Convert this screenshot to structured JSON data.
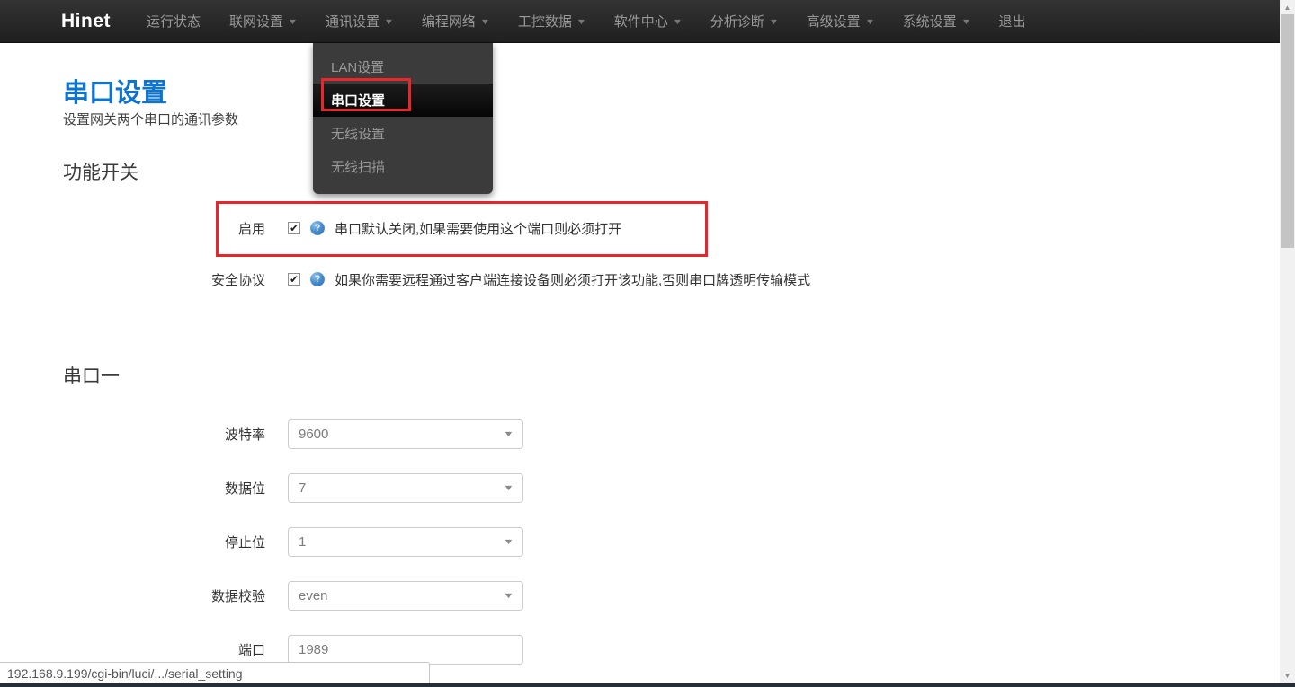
{
  "colors": {
    "accent_blue": "#0d74d1",
    "highlight_red": "#e8262b",
    "navbar_bg": "#2a2a2a",
    "dropdown_bg": "#3b3b3b",
    "taskbar_strip": "#233038"
  },
  "icons": {
    "caret": "▼",
    "check": "✔",
    "help": "?",
    "scroll_up": "▲",
    "scroll_down": "▼"
  },
  "navbar": {
    "brand": "Hinet",
    "items": [
      {
        "label": "运行状态",
        "caret": false
      },
      {
        "label": "联网设置",
        "caret": true
      },
      {
        "label": "通讯设置",
        "caret": true
      },
      {
        "label": "编程网络",
        "caret": true
      },
      {
        "label": "工控数据",
        "caret": true
      },
      {
        "label": "软件中心",
        "caret": true
      },
      {
        "label": "分析诊断",
        "caret": true
      },
      {
        "label": "高级设置",
        "caret": true
      },
      {
        "label": "系统设置",
        "caret": true
      },
      {
        "label": "退出",
        "caret": false
      }
    ]
  },
  "dropdown": {
    "items": [
      {
        "label": "LAN设置",
        "active": false
      },
      {
        "label": "串口设置",
        "active": true
      },
      {
        "label": "无线设置",
        "active": false
      },
      {
        "label": "无线扫描",
        "active": false
      }
    ]
  },
  "page": {
    "title": "串口设置",
    "subtitle": "设置网关两个串口的通讯参数"
  },
  "switch_section": {
    "heading": "功能开关",
    "rows": [
      {
        "label": "启用",
        "checked": true,
        "help": "串口默认关闭,如果需要使用这个端口则必须打开"
      },
      {
        "label": "安全协议",
        "checked": true,
        "help": "如果你需要远程通过客户端连接设备则必须打开该功能,否则串口牌透明传输模式"
      }
    ]
  },
  "serial_section": {
    "heading": "串口一",
    "fields": [
      {
        "label": "波特率",
        "value": "9600",
        "type": "select"
      },
      {
        "label": "数据位",
        "value": "7",
        "type": "select"
      },
      {
        "label": "停止位",
        "value": "1",
        "type": "select"
      },
      {
        "label": "数据校验",
        "value": "even",
        "type": "select"
      },
      {
        "label": "端口",
        "value": "1989",
        "type": "input"
      }
    ]
  },
  "statusbar": {
    "url": "192.168.9.199/cgi-bin/luci/.../serial_setting"
  }
}
